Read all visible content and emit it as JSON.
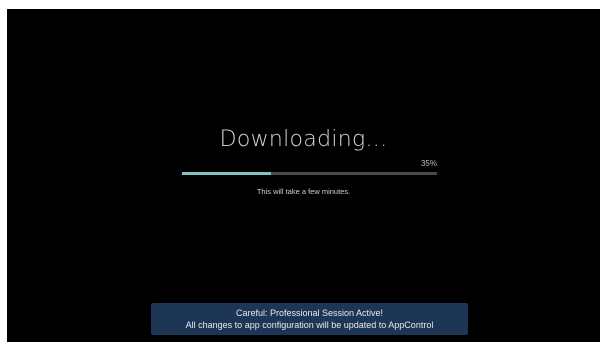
{
  "download": {
    "title": "Downloading...",
    "progress_percent": 35,
    "progress_label": "35%",
    "subtitle": "This will take a few minutes."
  },
  "banner": {
    "line1": "Careful: Professional Session Active!",
    "line2": "All changes to app configuration will be updated to AppControl"
  },
  "colors": {
    "background": "#000000",
    "progress_fill": "#7fc3c3",
    "progress_track": "#4a4a4a",
    "banner_background": "#1e3656"
  }
}
